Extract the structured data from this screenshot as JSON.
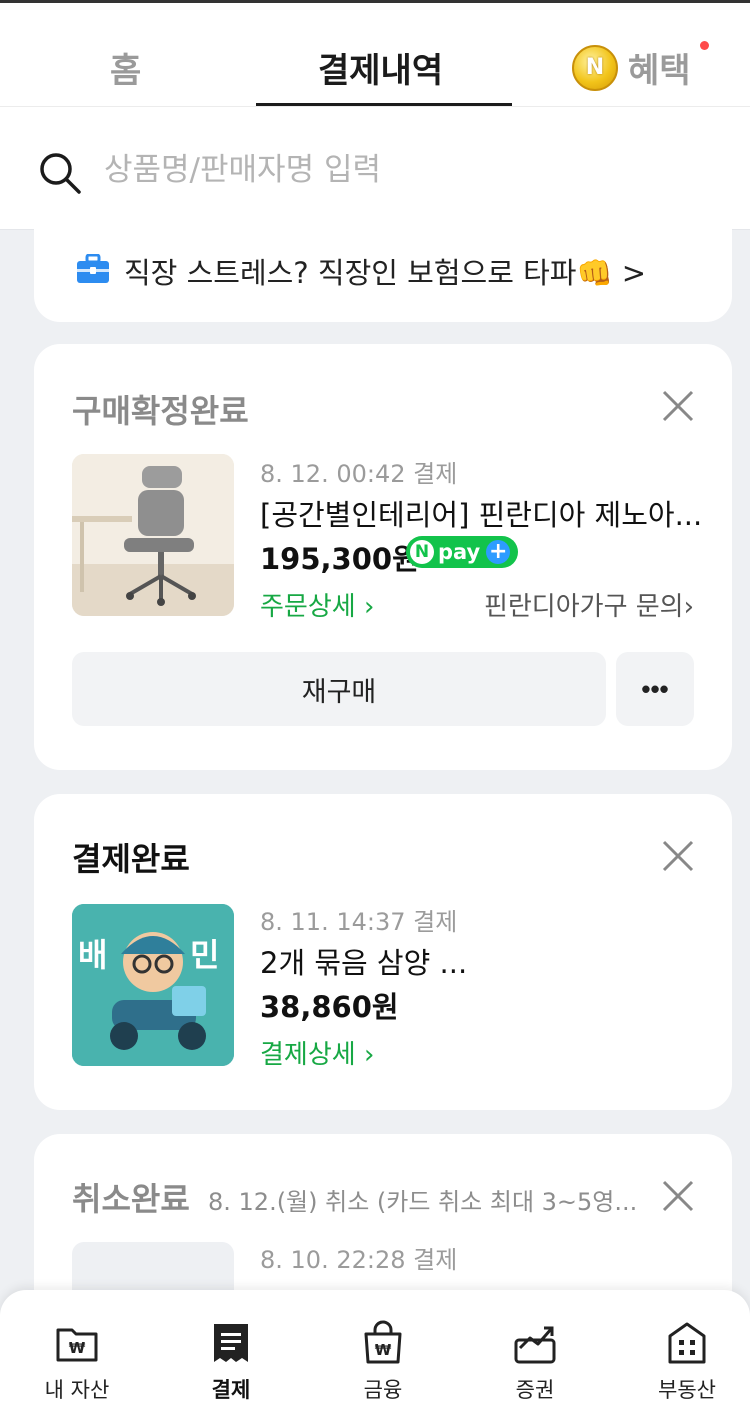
{
  "header": {
    "tabs": {
      "home": "홈",
      "payments": "결제내역",
      "benefits": "혜택"
    },
    "coin_label": "N"
  },
  "search": {
    "placeholder": "상품명/판매자명 입력"
  },
  "ad": {
    "text": "직장 스트레스? 직장인 보험으로 타파👊 >"
  },
  "orders": [
    {
      "status": "구매확정완료",
      "date": "8. 12. 00:42 결제",
      "name": "[공간별인테리어] 핀란디아 제노아...",
      "price": "195,300원",
      "npay_n": "N",
      "npay_text": "pay",
      "npay_plus": "+",
      "detail_link": "주문상세",
      "seller_link": "핀란디아가구 문의",
      "rebuy_label": "재구매",
      "more_label": "•••"
    },
    {
      "status": "결제완료",
      "date": "8. 11. 14:37 결제",
      "name": "2개 묶음 삼양 ...",
      "price": "38,860원",
      "detail_link": "결제상세",
      "thumb_text_left": "배",
      "thumb_text_right": "민"
    },
    {
      "status": "취소완료",
      "cancel_info": "8. 12.(월) 취소 (카드 취소 최대 3~5영...",
      "date": "8. 10. 22:28 결제"
    }
  ],
  "bottom_nav": {
    "items": [
      {
        "label": "내 자산",
        "icon": "wallet-icon"
      },
      {
        "label": "결제",
        "icon": "receipt-icon"
      },
      {
        "label": "금융",
        "icon": "bag-icon"
      },
      {
        "label": "증권",
        "icon": "chart-icon"
      },
      {
        "label": "부동산",
        "icon": "building-icon"
      }
    ],
    "active": "결제"
  },
  "colors": {
    "accent_green": "#17a844",
    "npay_green": "#12c34b",
    "text_dark": "#111111",
    "text_muted": "#9b9b9b"
  }
}
